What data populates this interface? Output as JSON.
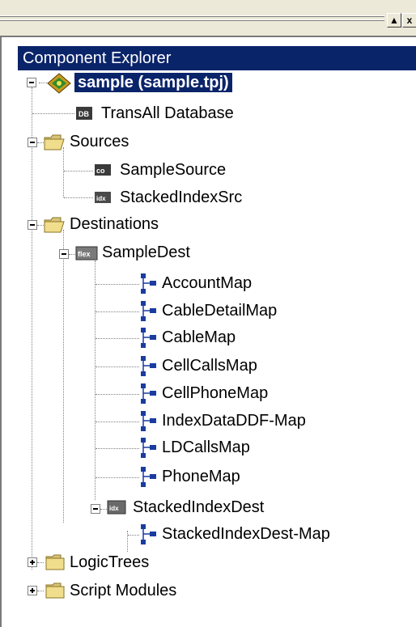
{
  "window": {
    "title": "Component Explorer",
    "buttons": {
      "scroll_up": "▲",
      "close": "x"
    }
  },
  "tree": {
    "root": {
      "label": "sample (sample.tpj)",
      "icon": "project-icon"
    },
    "items": [
      {
        "label": "TransAll Database",
        "icon": "database-icon"
      },
      {
        "label": "Sources",
        "icon": "folder-open-icon"
      },
      {
        "label": "SampleSource",
        "icon": "source-icon"
      },
      {
        "label": "StackedIndexSrc",
        "icon": "index-source-icon"
      },
      {
        "label": "Destinations",
        "icon": "folder-open-icon"
      },
      {
        "label": "SampleDest",
        "icon": "flex-dest-icon"
      },
      {
        "label": "AccountMap",
        "icon": "map-icon"
      },
      {
        "label": "CableDetailMap",
        "icon": "map-icon"
      },
      {
        "label": "CableMap",
        "icon": "map-icon"
      },
      {
        "label": "CellCallsMap",
        "icon": "map-icon"
      },
      {
        "label": "CellPhoneMap",
        "icon": "map-icon"
      },
      {
        "label": "IndexDataDDF-Map",
        "icon": "map-icon"
      },
      {
        "label": "LDCallsMap",
        "icon": "map-icon"
      },
      {
        "label": "PhoneMap",
        "icon": "map-icon"
      },
      {
        "label": "StackedIndexDest",
        "icon": "index-dest-icon"
      },
      {
        "label": "StackedIndexDest-Map",
        "icon": "map-icon"
      },
      {
        "label": "LogicTrees",
        "icon": "folder-closed-icon"
      },
      {
        "label": "Script Modules",
        "icon": "folder-closed-icon"
      }
    ]
  }
}
